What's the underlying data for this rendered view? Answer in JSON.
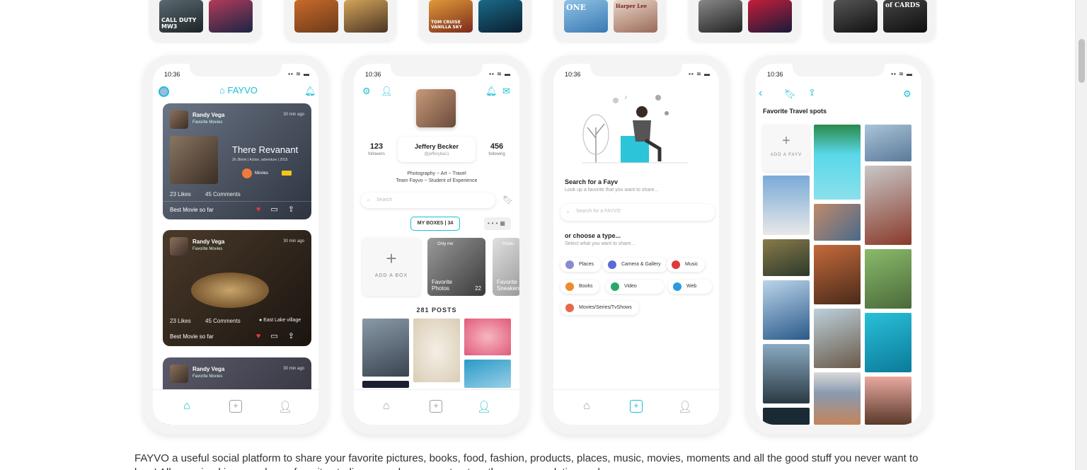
{
  "top_strip": {
    "card1_thumb1": "CALL DUTY MW3",
    "card6_thumb2": "of CARDS",
    "card3_thumb1": "TOM CRUISE VANILLA SKY",
    "card4_thumb1": "ONE",
    "card4_thumb2": "Harper Lee"
  },
  "status_time": "10:36",
  "feed": {
    "app_name": "FAYVO",
    "cards": [
      {
        "user": "Randy Vega",
        "category": "Favorite Movies",
        "time": "30 min ago",
        "title": "There Revanant",
        "meta": "2h 36min | Action, adventure | 2015",
        "tag": "Movies",
        "likes": "23 Likes",
        "comments": "45 Comments",
        "caption": "Best Movie so far"
      },
      {
        "user": "Randy Vega",
        "category": "Favorite Movies",
        "time": "30 min ago",
        "likes": "23 Likes",
        "comments": "45 Comments",
        "location": "East Lake village",
        "caption": "Best Movie so far"
      },
      {
        "user": "Randy Vega",
        "category": "Favorite Movies",
        "time": "30 min ago"
      }
    ]
  },
  "profile": {
    "followers_count": "123",
    "followers_label": "followers",
    "following_count": "456",
    "following_label": "following",
    "name": "Jeffery Becker",
    "handle": "@jefferybac1",
    "bio_line1": "Photography ~ Art ~ Travel",
    "bio_line2": "Team Fayvo ~ Student of Experience",
    "search_placeholder": "Search",
    "boxes_button": "MY BOXES | 34",
    "add_box": "ADD A BOX",
    "box1_badge": "Only me",
    "box1_label": "Favorite Photos",
    "box1_count": "22",
    "box2_badge": "Public",
    "box2_label": "Favorite Sneakers",
    "posts_title": "281 POSTS"
  },
  "search_screen": {
    "title": "Search for a Fayv",
    "subtitle": "Look up a favorite that you want to share...",
    "search_placeholder": "Search for a FAYVO",
    "type_title": "or choose a type...",
    "type_subtitle": "Select what you want to share...",
    "chips": [
      "Places",
      "Camera & Gallery",
      "Music",
      "Books",
      "Video",
      "Web",
      "Movies/Series/TvShows"
    ]
  },
  "travel_screen": {
    "title": "Favorite Travel spots",
    "add_fayv": "ADD A FAYV"
  },
  "description": "FAYVO a useful social platform to share your favorite pictures, books, food, fashion, products, places, music, movies, moments and all the good stuff you never want to lose! All organized in named your favorite studies, ... and ... connect ... together your ... relation ... d."
}
